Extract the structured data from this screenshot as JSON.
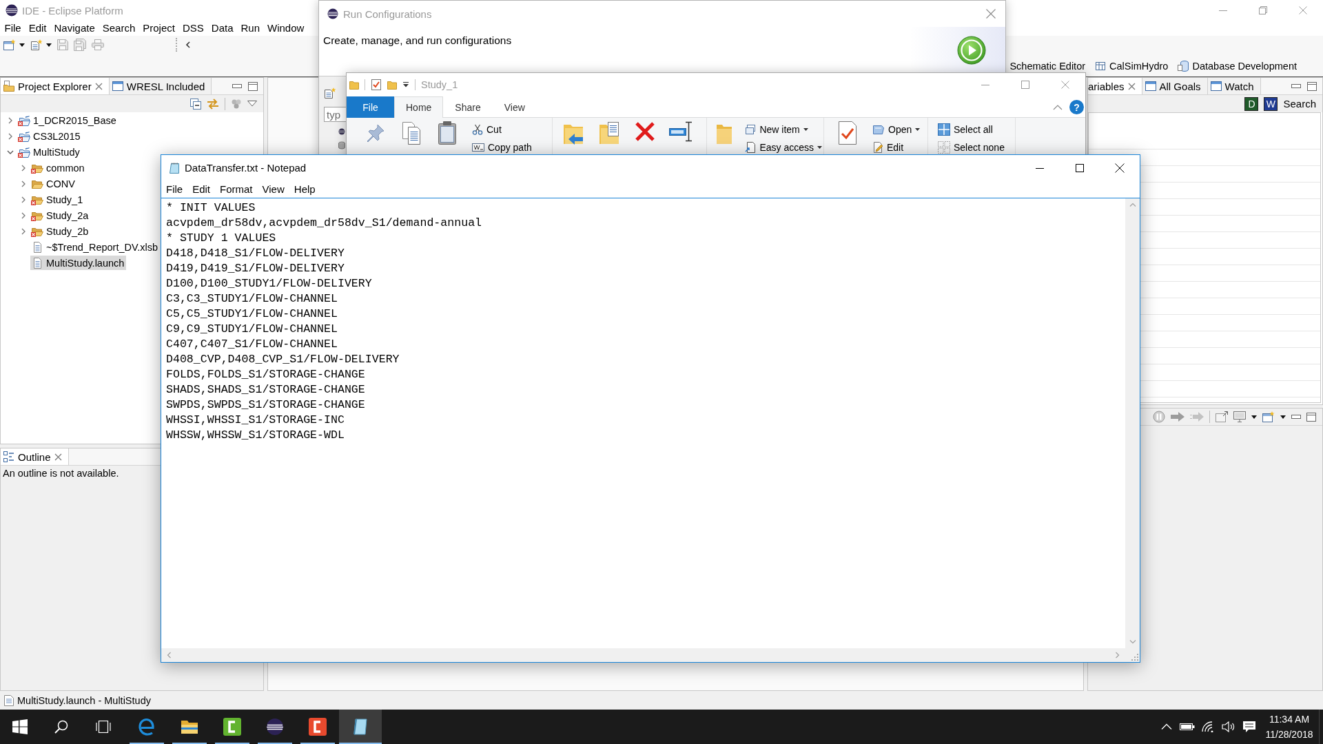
{
  "eclipse": {
    "title": "IDE - Eclipse Platform",
    "menu": [
      "File",
      "Edit",
      "Navigate",
      "Search",
      "Project",
      "DSS",
      "Data",
      "Run",
      "Window"
    ],
    "toolbar": [
      {
        "disabled": false,
        "dropdown": true
      },
      {
        "disabled": false,
        "dropdown": true
      },
      {
        "disabled": true,
        "dropdown": false
      },
      {
        "disabled": true,
        "dropdown": false
      },
      {
        "disabled": true,
        "dropdown": false
      }
    ],
    "perspectives": [
      "Schematic Editor",
      "CalSimHydro",
      "Database Development"
    ],
    "project_explorer": {
      "tabs": [
        {
          "label": "Project Explorer",
          "selected": true
        },
        {
          "label": "WRESL Included",
          "selected": false
        }
      ],
      "tree": [
        {
          "label": "1_DCR2015_Base",
          "kind": "project",
          "error": true,
          "expanded": false,
          "selected": false
        },
        {
          "label": "CS3L2015",
          "kind": "project",
          "error": true,
          "expanded": false,
          "selected": false
        },
        {
          "label": "MultiStudy",
          "kind": "project",
          "error": true,
          "expanded": true,
          "selected": false,
          "children": [
            {
              "label": "common",
              "kind": "folder",
              "error": true,
              "expanded": false,
              "selected": false
            },
            {
              "label": "CONV",
              "kind": "folder",
              "error": false,
              "expanded": false,
              "selected": false
            },
            {
              "label": "Study_1",
              "kind": "folder",
              "error": true,
              "expanded": false,
              "selected": false
            },
            {
              "label": "Study_2a",
              "kind": "folder",
              "error": true,
              "expanded": false,
              "selected": false
            },
            {
              "label": "Study_2b",
              "kind": "folder",
              "error": true,
              "expanded": false,
              "selected": false
            },
            {
              "label": "~$Trend_Report_DV.xlsb",
              "kind": "file",
              "error": false,
              "selected": false
            },
            {
              "label": "MultiStudy.launch",
              "kind": "file",
              "error": false,
              "selected": true
            }
          ]
        }
      ]
    },
    "outline": {
      "tabs": [
        {
          "label": "Outline",
          "selected": true
        }
      ],
      "message": "An outline is not available."
    },
    "variables": {
      "tabs": [
        {
          "label": "ariables",
          "selected": true
        },
        {
          "label": "All Goals",
          "selected": false
        },
        {
          "label": "Watch",
          "selected": false
        }
      ],
      "tool_tiles": [
        "D",
        "W"
      ],
      "search": "Search"
    },
    "status_bar": "MultiStudy.launch - MultiStudy"
  },
  "run_configurations": {
    "title": "Run Configurations",
    "heading": "Create, manage, and run configurations",
    "filter": {
      "placeholder": "typ"
    }
  },
  "file_explorer": {
    "title": "Study_1",
    "tabs": [
      {
        "label": "File",
        "kind": "menu",
        "selected": false
      },
      {
        "label": "Home",
        "kind": "tab",
        "selected": true
      },
      {
        "label": "Share",
        "kind": "tab",
        "selected": false
      },
      {
        "label": "View",
        "kind": "tab",
        "selected": false
      }
    ],
    "help": "?",
    "ribbon": {
      "groups": [
        {
          "commands": [
            {
              "kind": "large"
            },
            {
              "kind": "large"
            },
            {
              "kind": "large"
            },
            {
              "kind": "small",
              "label": "Cut",
              "dropdown": false
            },
            {
              "kind": "small",
              "label": "Copy path",
              "dropdown": false
            }
          ]
        },
        {
          "commands": [
            {
              "kind": "large"
            },
            {
              "kind": "large"
            },
            {
              "kind": "large"
            },
            {
              "kind": "large"
            }
          ]
        },
        {
          "commands": [
            {
              "kind": "large"
            },
            {
              "kind": "small",
              "label": "New item",
              "dropdown": true
            },
            {
              "kind": "small",
              "label": "Easy access",
              "dropdown": true
            }
          ]
        },
        {
          "commands": [
            {
              "kind": "large"
            },
            {
              "kind": "small",
              "label": "Open",
              "dropdown": true
            },
            {
              "kind": "small",
              "label": "Edit",
              "dropdown": false
            }
          ]
        },
        {
          "commands": [
            {
              "kind": "small",
              "label": "Select all",
              "dropdown": false
            },
            {
              "kind": "small",
              "label": "Select none",
              "dropdown": false
            }
          ]
        }
      ]
    }
  },
  "notepad": {
    "title": "DataTransfer.txt - Notepad",
    "menu": [
      "File",
      "Edit",
      "Format",
      "View",
      "Help"
    ],
    "lines": [
      "* INIT VALUES",
      "acvpdem_dr58dv,acvpdem_dr58dv_S1/demand-annual",
      "* STUDY 1 VALUES",
      "D418,D418_S1/FLOW-DELIVERY",
      "D419,D419_S1/FLOW-DELIVERY",
      "D100,D100_STUDY1/FLOW-DELIVERY",
      "C3,C3_STUDY1/FLOW-CHANNEL",
      "C5,C5_STUDY1/FLOW-CHANNEL",
      "C9,C9_STUDY1/FLOW-CHANNEL",
      "C407,C407_S1/FLOW-CHANNEL",
      "D408_CVP,D408_CVP_S1/FLOW-DELIVERY",
      "FOLDS,FOLDS_S1/STORAGE-CHANGE",
      "SHADS,SHADS_S1/STORAGE-CHANGE",
      "SWPDS,SWPDS_S1/STORAGE-CHANGE",
      "WHSSI,WHSSI_S1/STORAGE-INC",
      "WHSSW,WHSSW_S1/STORAGE-WDL"
    ]
  },
  "taskbar": {
    "apps": [
      {
        "selected": false,
        "running": true
      },
      {
        "selected": false,
        "running": true
      },
      {
        "selected": false,
        "running": true
      },
      {
        "selected": false,
        "running": true
      },
      {
        "selected": false,
        "running": true
      },
      {
        "selected": true,
        "running": true
      }
    ],
    "clock": {
      "time": "11:34 AM",
      "date": "11/28/2018"
    }
  }
}
